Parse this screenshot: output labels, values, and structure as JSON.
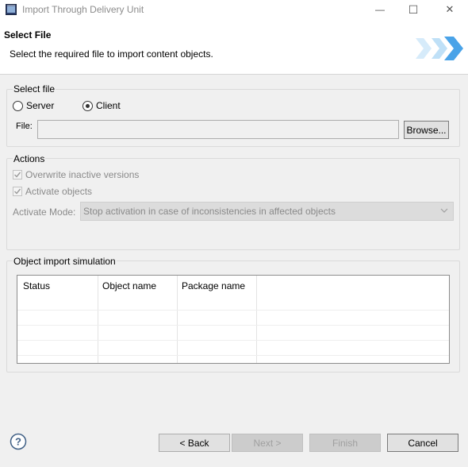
{
  "window": {
    "title": "Import Through Delivery Unit",
    "minimize_glyph": "—",
    "maximize_glyph": "☐",
    "close_glyph": "✕"
  },
  "header": {
    "title": "Select File",
    "description": "Select the required file to import content objects."
  },
  "select_file": {
    "label": "Select file",
    "server_label": "Server",
    "client_label": "Client",
    "selected": "Client",
    "file_label": "File:",
    "file_value": "",
    "browse_label": "Browse..."
  },
  "actions": {
    "label": "Actions",
    "overwrite_label": "Overwrite inactive versions",
    "overwrite_checked": true,
    "activate_label": "Activate objects",
    "activate_checked": true,
    "mode_label": "Activate Mode:",
    "mode_value": "Stop activation in case of inconsistencies in affected objects"
  },
  "simulation": {
    "label": "Object import simulation",
    "columns": [
      "Status",
      "Object name",
      "Package name"
    ]
  },
  "footer": {
    "back_label": "< Back",
    "next_label": "Next >",
    "finish_label": "Finish",
    "cancel_label": "Cancel"
  },
  "icons": {
    "app": "eclipse-window-icon",
    "help": "help-question-icon",
    "banner": "double-chevron-banner-icon"
  },
  "colors": {
    "banner_blue": "#4aa3e8",
    "banner_light": "#bfe0f7"
  }
}
